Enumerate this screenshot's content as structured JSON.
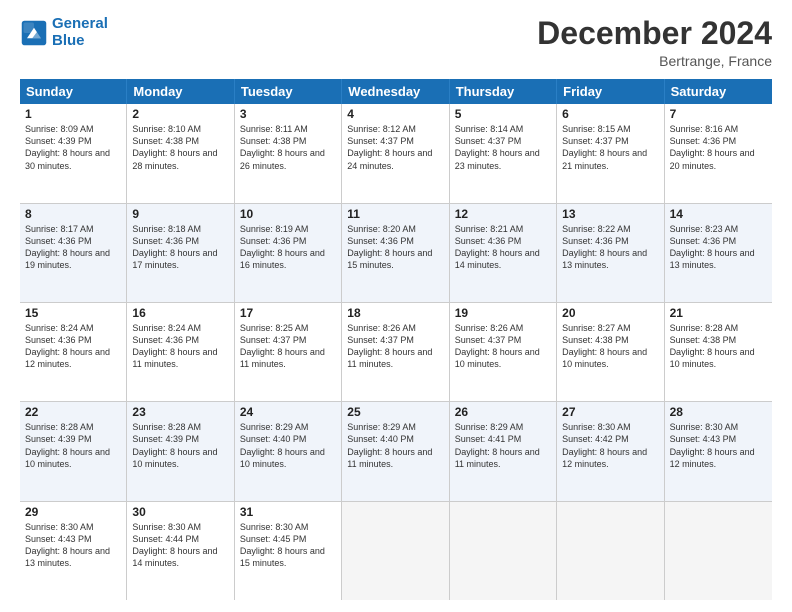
{
  "header": {
    "logo_line1": "General",
    "logo_line2": "Blue",
    "month_title": "December 2024",
    "location": "Bertrange, France"
  },
  "weekdays": [
    "Sunday",
    "Monday",
    "Tuesday",
    "Wednesday",
    "Thursday",
    "Friday",
    "Saturday"
  ],
  "weeks": [
    [
      {
        "day": "1",
        "sunrise": "Sunrise: 8:09 AM",
        "sunset": "Sunset: 4:39 PM",
        "daylight": "Daylight: 8 hours and 30 minutes."
      },
      {
        "day": "2",
        "sunrise": "Sunrise: 8:10 AM",
        "sunset": "Sunset: 4:38 PM",
        "daylight": "Daylight: 8 hours and 28 minutes."
      },
      {
        "day": "3",
        "sunrise": "Sunrise: 8:11 AM",
        "sunset": "Sunset: 4:38 PM",
        "daylight": "Daylight: 8 hours and 26 minutes."
      },
      {
        "day": "4",
        "sunrise": "Sunrise: 8:12 AM",
        "sunset": "Sunset: 4:37 PM",
        "daylight": "Daylight: 8 hours and 24 minutes."
      },
      {
        "day": "5",
        "sunrise": "Sunrise: 8:14 AM",
        "sunset": "Sunset: 4:37 PM",
        "daylight": "Daylight: 8 hours and 23 minutes."
      },
      {
        "day": "6",
        "sunrise": "Sunrise: 8:15 AM",
        "sunset": "Sunset: 4:37 PM",
        "daylight": "Daylight: 8 hours and 21 minutes."
      },
      {
        "day": "7",
        "sunrise": "Sunrise: 8:16 AM",
        "sunset": "Sunset: 4:36 PM",
        "daylight": "Daylight: 8 hours and 20 minutes."
      }
    ],
    [
      {
        "day": "8",
        "sunrise": "Sunrise: 8:17 AM",
        "sunset": "Sunset: 4:36 PM",
        "daylight": "Daylight: 8 hours and 19 minutes."
      },
      {
        "day": "9",
        "sunrise": "Sunrise: 8:18 AM",
        "sunset": "Sunset: 4:36 PM",
        "daylight": "Daylight: 8 hours and 17 minutes."
      },
      {
        "day": "10",
        "sunrise": "Sunrise: 8:19 AM",
        "sunset": "Sunset: 4:36 PM",
        "daylight": "Daylight: 8 hours and 16 minutes."
      },
      {
        "day": "11",
        "sunrise": "Sunrise: 8:20 AM",
        "sunset": "Sunset: 4:36 PM",
        "daylight": "Daylight: 8 hours and 15 minutes."
      },
      {
        "day": "12",
        "sunrise": "Sunrise: 8:21 AM",
        "sunset": "Sunset: 4:36 PM",
        "daylight": "Daylight: 8 hours and 14 minutes."
      },
      {
        "day": "13",
        "sunrise": "Sunrise: 8:22 AM",
        "sunset": "Sunset: 4:36 PM",
        "daylight": "Daylight: 8 hours and 13 minutes."
      },
      {
        "day": "14",
        "sunrise": "Sunrise: 8:23 AM",
        "sunset": "Sunset: 4:36 PM",
        "daylight": "Daylight: 8 hours and 13 minutes."
      }
    ],
    [
      {
        "day": "15",
        "sunrise": "Sunrise: 8:24 AM",
        "sunset": "Sunset: 4:36 PM",
        "daylight": "Daylight: 8 hours and 12 minutes."
      },
      {
        "day": "16",
        "sunrise": "Sunrise: 8:24 AM",
        "sunset": "Sunset: 4:36 PM",
        "daylight": "Daylight: 8 hours and 11 minutes."
      },
      {
        "day": "17",
        "sunrise": "Sunrise: 8:25 AM",
        "sunset": "Sunset: 4:37 PM",
        "daylight": "Daylight: 8 hours and 11 minutes."
      },
      {
        "day": "18",
        "sunrise": "Sunrise: 8:26 AM",
        "sunset": "Sunset: 4:37 PM",
        "daylight": "Daylight: 8 hours and 11 minutes."
      },
      {
        "day": "19",
        "sunrise": "Sunrise: 8:26 AM",
        "sunset": "Sunset: 4:37 PM",
        "daylight": "Daylight: 8 hours and 10 minutes."
      },
      {
        "day": "20",
        "sunrise": "Sunrise: 8:27 AM",
        "sunset": "Sunset: 4:38 PM",
        "daylight": "Daylight: 8 hours and 10 minutes."
      },
      {
        "day": "21",
        "sunrise": "Sunrise: 8:28 AM",
        "sunset": "Sunset: 4:38 PM",
        "daylight": "Daylight: 8 hours and 10 minutes."
      }
    ],
    [
      {
        "day": "22",
        "sunrise": "Sunrise: 8:28 AM",
        "sunset": "Sunset: 4:39 PM",
        "daylight": "Daylight: 8 hours and 10 minutes."
      },
      {
        "day": "23",
        "sunrise": "Sunrise: 8:28 AM",
        "sunset": "Sunset: 4:39 PM",
        "daylight": "Daylight: 8 hours and 10 minutes."
      },
      {
        "day": "24",
        "sunrise": "Sunrise: 8:29 AM",
        "sunset": "Sunset: 4:40 PM",
        "daylight": "Daylight: 8 hours and 10 minutes."
      },
      {
        "day": "25",
        "sunrise": "Sunrise: 8:29 AM",
        "sunset": "Sunset: 4:40 PM",
        "daylight": "Daylight: 8 hours and 11 minutes."
      },
      {
        "day": "26",
        "sunrise": "Sunrise: 8:29 AM",
        "sunset": "Sunset: 4:41 PM",
        "daylight": "Daylight: 8 hours and 11 minutes."
      },
      {
        "day": "27",
        "sunrise": "Sunrise: 8:30 AM",
        "sunset": "Sunset: 4:42 PM",
        "daylight": "Daylight: 8 hours and 12 minutes."
      },
      {
        "day": "28",
        "sunrise": "Sunrise: 8:30 AM",
        "sunset": "Sunset: 4:43 PM",
        "daylight": "Daylight: 8 hours and 12 minutes."
      }
    ],
    [
      {
        "day": "29",
        "sunrise": "Sunrise: 8:30 AM",
        "sunset": "Sunset: 4:43 PM",
        "daylight": "Daylight: 8 hours and 13 minutes."
      },
      {
        "day": "30",
        "sunrise": "Sunrise: 8:30 AM",
        "sunset": "Sunset: 4:44 PM",
        "daylight": "Daylight: 8 hours and 14 minutes."
      },
      {
        "day": "31",
        "sunrise": "Sunrise: 8:30 AM",
        "sunset": "Sunset: 4:45 PM",
        "daylight": "Daylight: 8 hours and 15 minutes."
      },
      null,
      null,
      null,
      null
    ]
  ]
}
